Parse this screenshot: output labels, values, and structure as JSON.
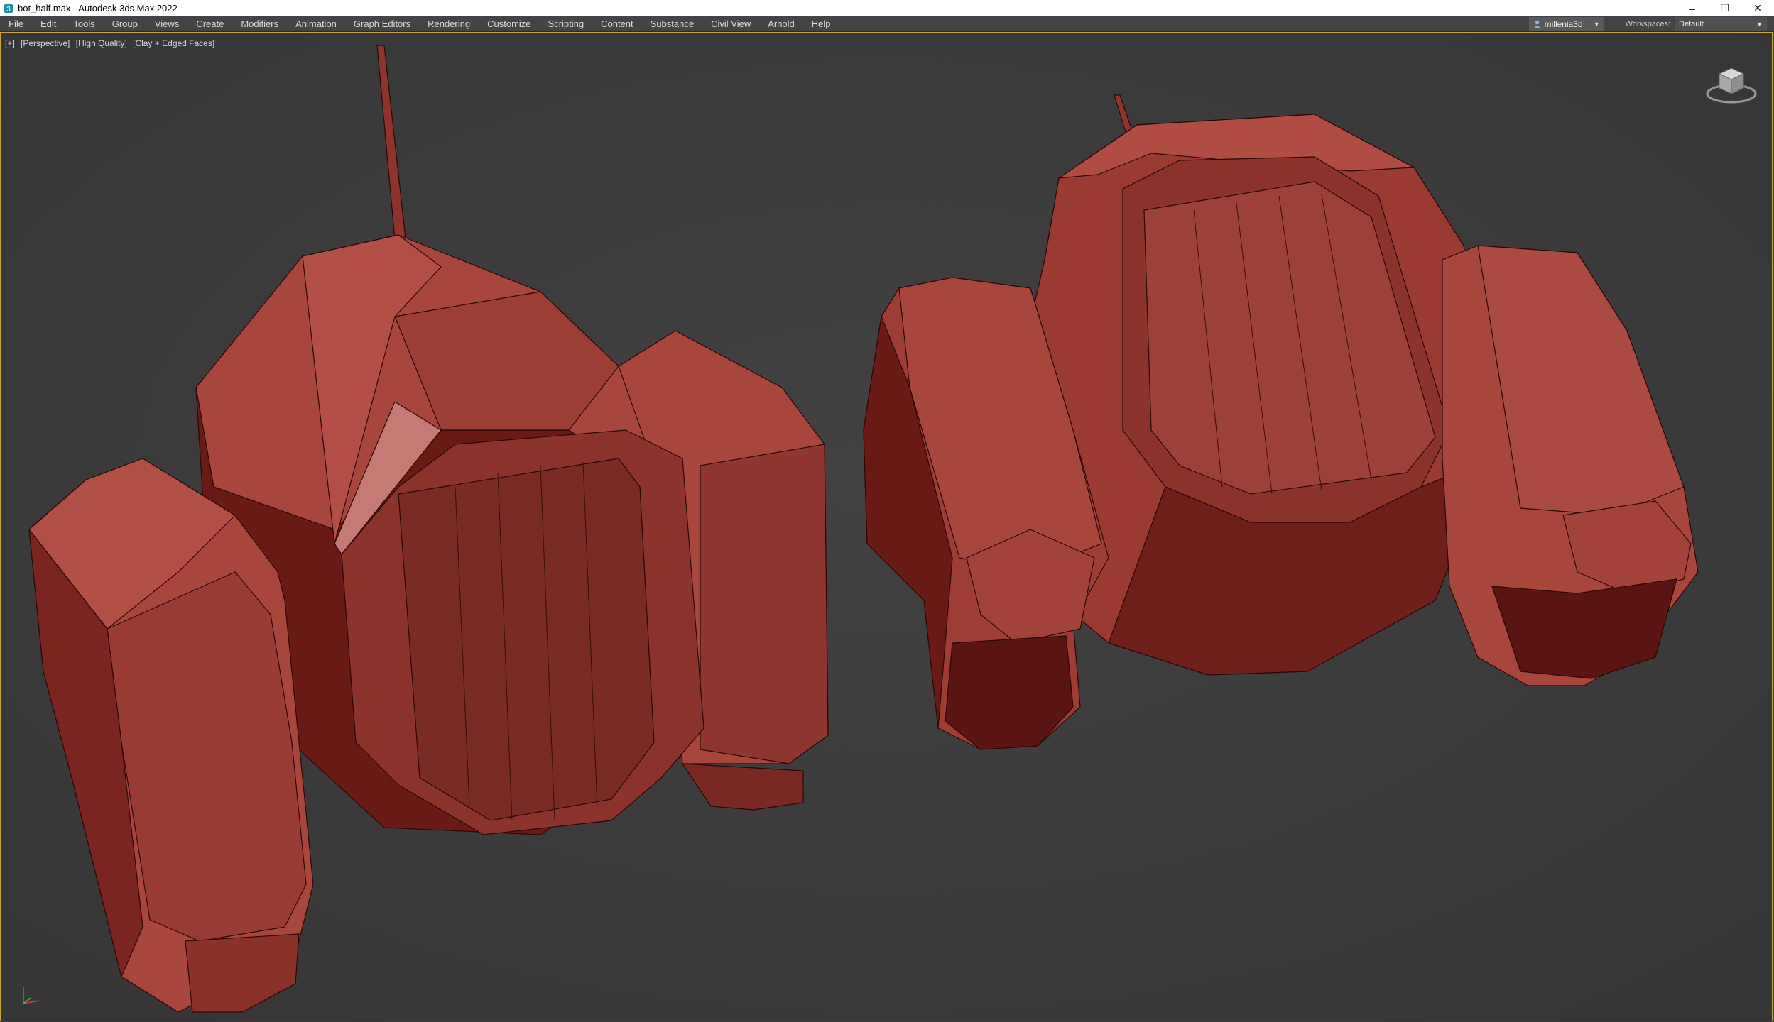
{
  "window": {
    "title": "bot_half.max - Autodesk 3ds Max 2022",
    "controls": {
      "minimize": "–",
      "restore": "❐",
      "close": "✕"
    }
  },
  "menu": {
    "items": [
      "File",
      "Edit",
      "Tools",
      "Group",
      "Views",
      "Create",
      "Modifiers",
      "Animation",
      "Graph Editors",
      "Rendering",
      "Customize",
      "Scripting",
      "Content",
      "Substance",
      "Civil View",
      "Arnold",
      "Help"
    ],
    "user": "millenia3d",
    "workspaces_label": "Workspaces:",
    "workspaces_value": "Default"
  },
  "viewport": {
    "labels": [
      "[+]",
      "[Perspective]",
      "[High Quality]",
      "[Clay + Edged Faces]"
    ],
    "border_color": "#c8a638",
    "mesh_color": "#a8463d"
  }
}
